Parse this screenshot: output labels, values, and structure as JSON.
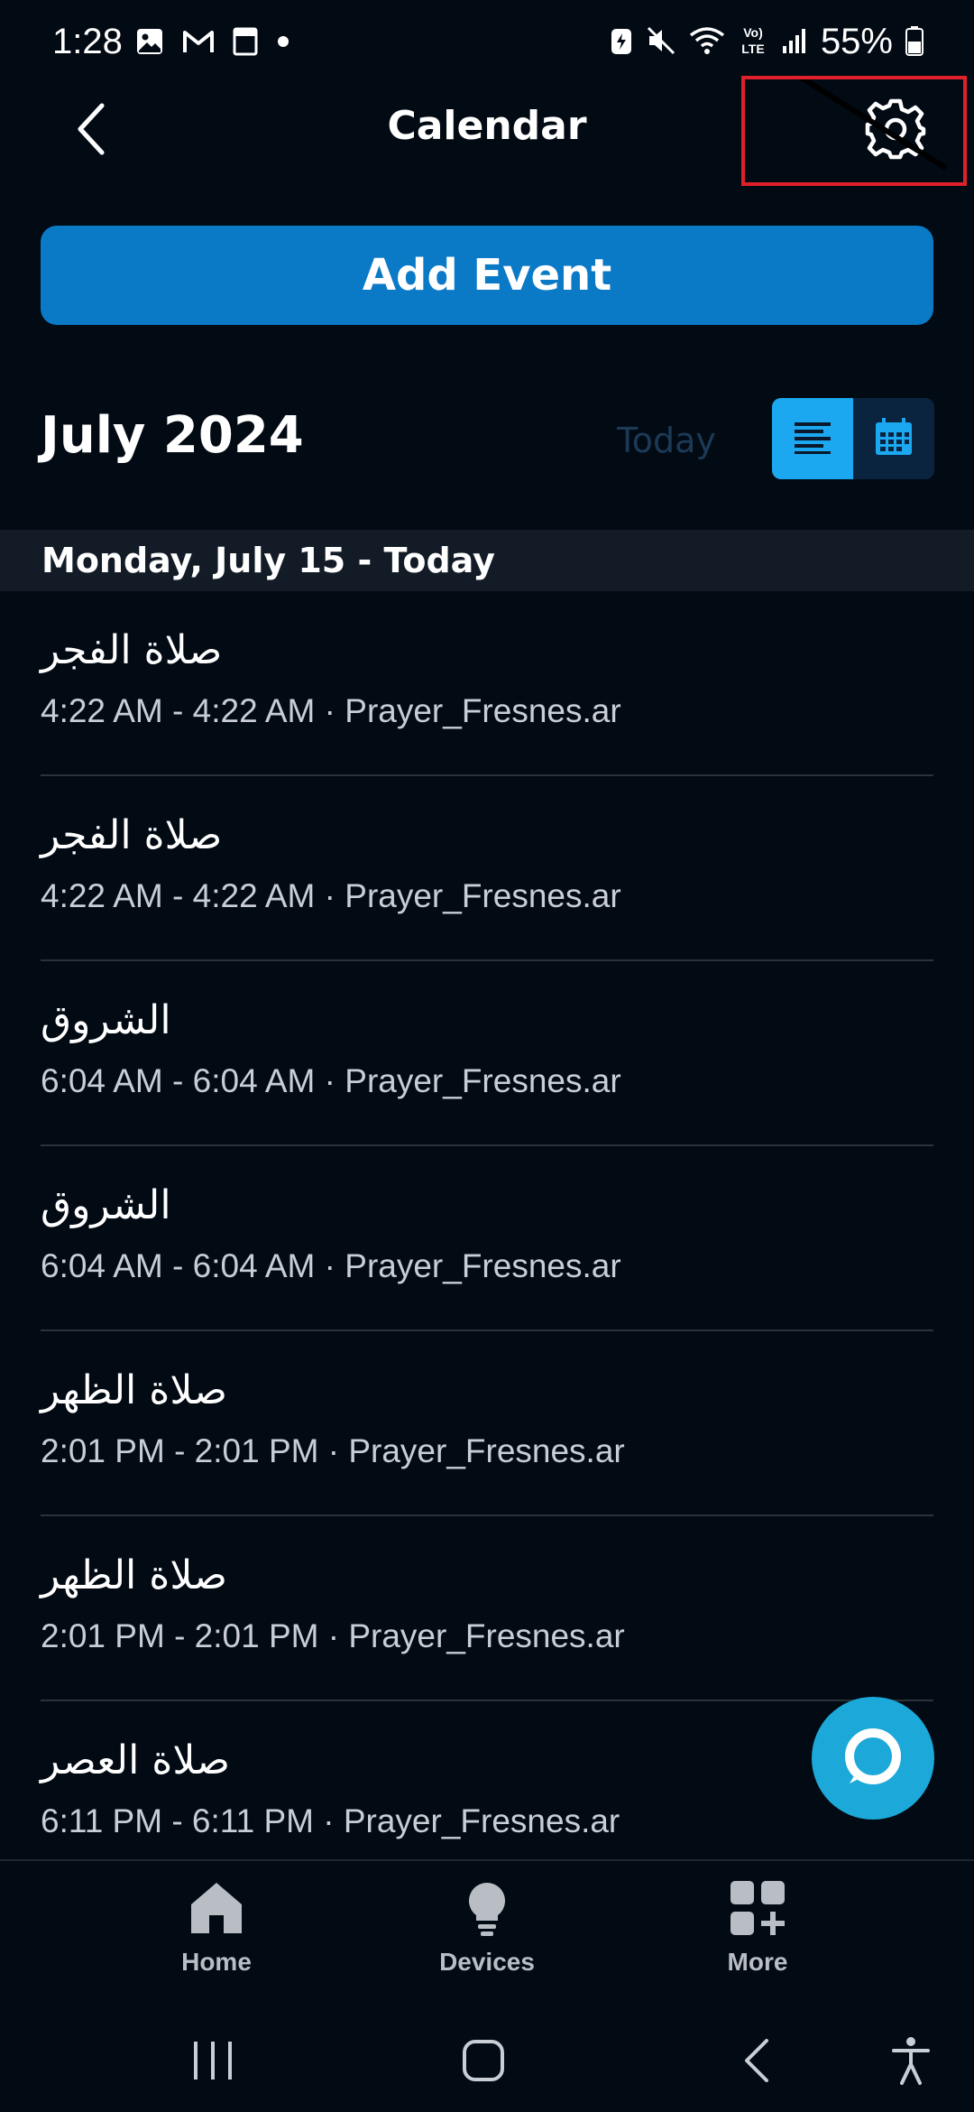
{
  "status_bar": {
    "time": "1:28",
    "battery_percent": "55%",
    "volte_label": "Vo) LTE",
    "left_icons": [
      "image-icon",
      "gmail-icon",
      "notes-icon",
      "dot-icon"
    ],
    "right_icons": [
      "battery-saver-icon",
      "mute-icon",
      "wifi-icon",
      "volte-icon",
      "signal-icon",
      "battery-icon"
    ]
  },
  "header": {
    "title": "Calendar",
    "back_icon": "back-arrow-icon",
    "settings_icon": "gear-icon"
  },
  "add_event_label": "Add Event",
  "month": {
    "title": "July 2024",
    "today_label": "Today",
    "active_view": "list"
  },
  "day_header": "Monday, July 15 - Today",
  "events": [
    {
      "title": "صلاة الفجر",
      "time": "4:22 AM - 4:22 AM · Prayer_Fresnes.ar"
    },
    {
      "title": "صلاة الفجر",
      "time": "4:22 AM - 4:22 AM · Prayer_Fresnes.ar"
    },
    {
      "title": "الشروق",
      "time": "6:04 AM - 6:04 AM · Prayer_Fresnes.ar"
    },
    {
      "title": "الشروق",
      "time": "6:04 AM - 6:04 AM · Prayer_Fresnes.ar"
    },
    {
      "title": "صلاة الظهر",
      "time": "2:01 PM - 2:01 PM · Prayer_Fresnes.ar"
    },
    {
      "title": "صلاة الظهر",
      "time": "2:01 PM - 2:01 PM · Prayer_Fresnes.ar"
    },
    {
      "title": "صلاة العصر",
      "time": "6:11 PM - 6:11 PM · Prayer_Fresnes.ar"
    }
  ],
  "bottom_nav": [
    {
      "label": "Home",
      "icon": "home-icon"
    },
    {
      "label": "Devices",
      "icon": "lightbulb-icon"
    },
    {
      "label": "More",
      "icon": "more-grid-icon"
    }
  ],
  "colors": {
    "background": "#020a14",
    "accent": "#0a7ac6",
    "toggle_active": "#1ca8f0",
    "alexa": "#1ca8d8",
    "highlight_box": "#e0202a"
  }
}
